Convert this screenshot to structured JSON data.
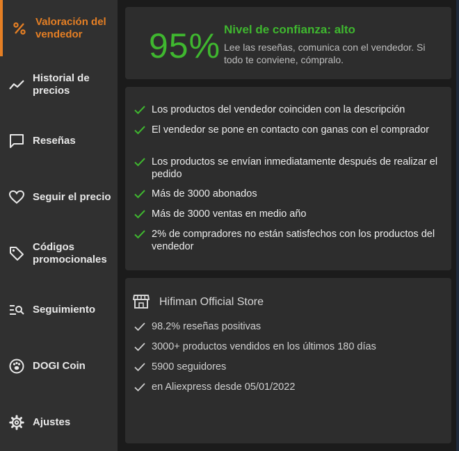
{
  "sidebar": {
    "items": [
      {
        "label": "Valoración del vendedor",
        "icon": "percent-icon",
        "active": true
      },
      {
        "label": "Historial de precios",
        "icon": "trend-line-icon",
        "active": false
      },
      {
        "label": "Reseñas",
        "icon": "chat-bubble-icon",
        "active": false
      },
      {
        "label": "Seguir el precio",
        "icon": "heart-icon",
        "active": false
      },
      {
        "label": "Códigos promocionales",
        "icon": "tag-icon",
        "active": false
      },
      {
        "label": "Seguimiento",
        "icon": "search-list-icon",
        "active": false
      },
      {
        "label": "DOGI Coin",
        "icon": "paw-icon",
        "active": false
      },
      {
        "label": "Ajustes",
        "icon": "gear-icon",
        "active": false
      }
    ]
  },
  "trust": {
    "score": "95%",
    "title": "Nivel de confianza: alto",
    "description": "Lee las reseñas, comunica con el vendedor. Si todo te conviene, cómpralo."
  },
  "checks": [
    "Los productos del vendedor coinciden con la descripción",
    "El vendedor se pone en contacto con ganas con el comprador",
    "Los productos se envían inmediatamente después de realizar el pedido",
    "Más de 3000 abonados",
    "Más de 3000 ventas en medio año",
    "2% de compradores no están satisfechos con los productos del vendedor"
  ],
  "store": {
    "name": "Hifiman Official Store",
    "icon": "store-icon",
    "stats": [
      "98.2% reseñas positivas",
      "3000+ productos vendidos en los últimos 180 días",
      "5900 seguidores",
      "en Aliexpress desde 05/01/2022"
    ]
  },
  "colors": {
    "accent": "#e57f24",
    "success": "#3fb72f",
    "sidebar_bg": "#303030",
    "card_bg": "#2d2d2d"
  }
}
